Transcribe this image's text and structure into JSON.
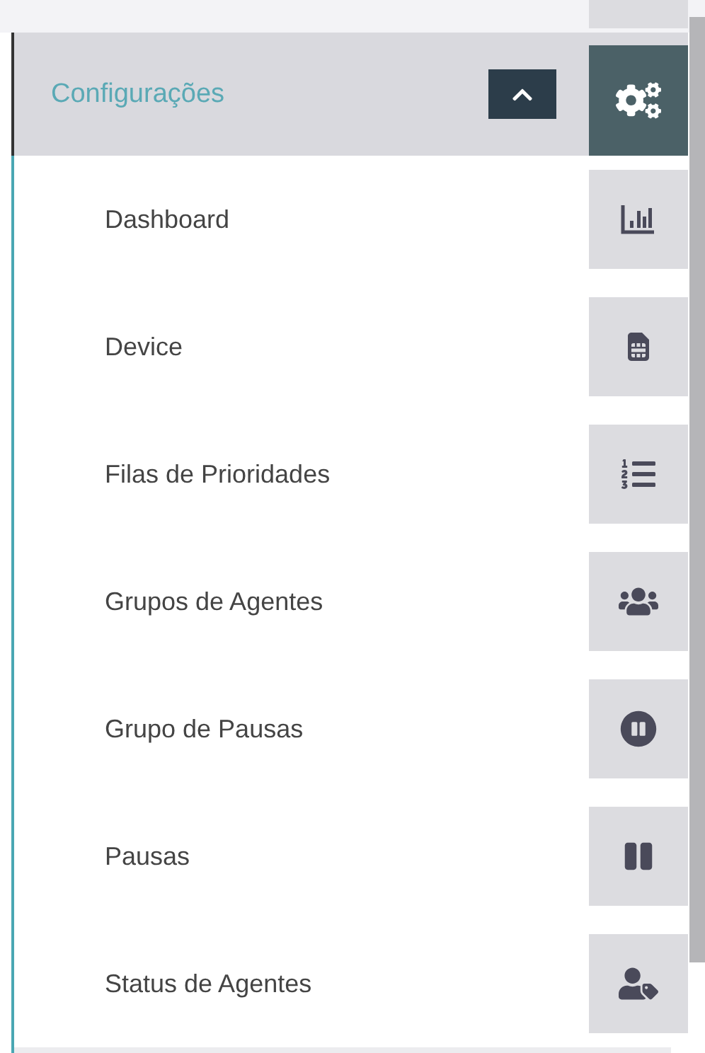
{
  "menu": {
    "title": "Configurações",
    "expanded": true,
    "items": [
      {
        "label": "Dashboard"
      },
      {
        "label": "Device"
      },
      {
        "label": "Filas de Prioridades"
      },
      {
        "label": "Grupos de Agentes"
      },
      {
        "label": "Grupo de Pausas"
      },
      {
        "label": "Pausas"
      },
      {
        "label": "Status de Agentes"
      }
    ]
  }
}
